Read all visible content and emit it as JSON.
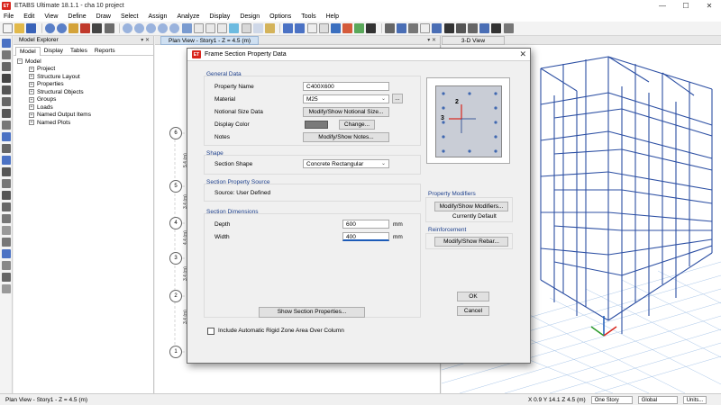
{
  "window": {
    "logo_text": "ET",
    "title": "ETABS Ultimate 18.1.1 - cha 10 project",
    "controls": [
      "—",
      "☐",
      "✕"
    ]
  },
  "menu": [
    "File",
    "Edit",
    "View",
    "Define",
    "Draw",
    "Select",
    "Assign",
    "Analyze",
    "Display",
    "Design",
    "Options",
    "Tools",
    "Help"
  ],
  "explorer": {
    "title": "Model Explorer",
    "tabs": [
      "Model",
      "Display",
      "Tables",
      "Reports"
    ],
    "root": "Model",
    "items": [
      "Project",
      "Structure Layout",
      "Properties",
      "Structural Objects",
      "Groups",
      "Loads",
      "Named Output Items",
      "Named Plots"
    ]
  },
  "plan_view": {
    "tab_label": "Plan View - Story1 - Z = 4.5 (m)",
    "grid_bubbles": [
      "6",
      "5",
      "4",
      "3",
      "2",
      "1"
    ],
    "spacing_labels": [
      "5.4 (m)",
      "3.4 (m)",
      "4.4 (m)",
      "3.4 (m)",
      "3.4 (m)"
    ]
  },
  "view3d": {
    "tab_label": "3-D View"
  },
  "dialog": {
    "logo_text": "ET",
    "title": "Frame Section Property Data",
    "general_data": {
      "label": "General Data",
      "property_name_label": "Property Name",
      "property_name": "C400X600",
      "material_label": "Material",
      "material": "M25",
      "material_more": "...",
      "notional_label": "Notional Size Data",
      "notional_button": "Modify/Show Notional Size...",
      "color_label": "Display Color",
      "color_button": "Change...",
      "color_swatch": "#7a7a7a",
      "notes_label": "Notes",
      "notes_button": "Modify/Show Notes..."
    },
    "shape": {
      "label": "Shape",
      "section_shape_label": "Section Shape",
      "section_shape": "Concrete Rectangular"
    },
    "source": {
      "label": "Section Property Source",
      "text": "Source:  User Defined"
    },
    "dimensions": {
      "label": "Section Dimensions",
      "depth_label": "Depth",
      "depth": "600",
      "width_label": "Width",
      "width": "400",
      "unit": "mm"
    },
    "preview": {
      "axis2": "2",
      "axis3": "3"
    },
    "modifiers": {
      "label": "Property Modifiers",
      "button": "Modify/Show Modifiers...",
      "status": "Currently Default"
    },
    "reinforcement": {
      "label": "Reinforcement",
      "button": "Modify/Show Rebar..."
    },
    "show_props_button": "Show Section Properties...",
    "ok": "OK",
    "cancel": "Cancel",
    "rigid_zone_label": "Include Automatic Rigid Zone Area Over Column"
  },
  "status": {
    "left": "Plan View - Story1 - Z = 4.5 (m)",
    "coords": "X 0.9  Y 14.1  Z 4.5 (m)",
    "story": "One Story",
    "coord_sys": "Global",
    "units": "Units..."
  },
  "colors": {
    "accent": "#1c5bb8",
    "logo_red": "#d9251c",
    "frame_blue": "#2c4fa3"
  }
}
